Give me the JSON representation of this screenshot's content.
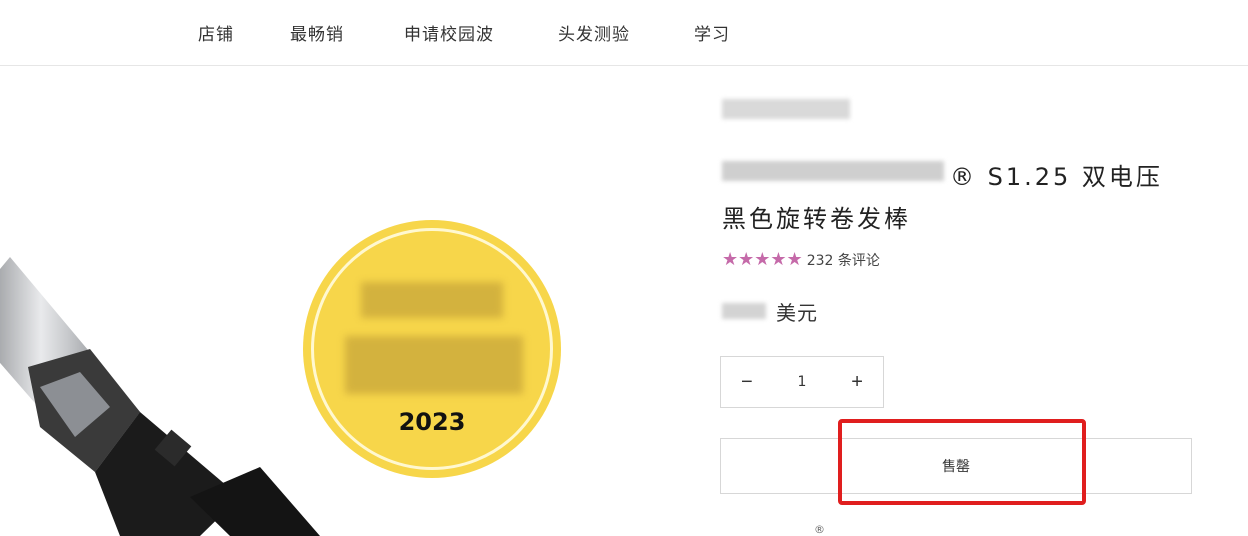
{
  "nav": {
    "items": [
      {
        "label": "店铺"
      },
      {
        "label": "最畅销"
      },
      {
        "label": "申请校园波"
      },
      {
        "label": "头发测验"
      },
      {
        "label": "学习"
      }
    ]
  },
  "media": {
    "badge": {
      "year": "2023",
      "color": "#f7d64a"
    }
  },
  "product": {
    "title_line1": "® S1.25 双电压",
    "title_line2": "黑色旋转卷发棒",
    "rating": {
      "stars": "★★★★★",
      "value": 5,
      "review_text": "232 条评论",
      "star_color": "#c56aa9"
    },
    "price": {
      "unit": "美元"
    },
    "quantity": {
      "decrease": "−",
      "value": "1",
      "increase": "+"
    },
    "sold_out_label": "售罄",
    "footnote_mark": "®"
  },
  "colors": {
    "highlight": "#e01e1e",
    "border": "#d7d7d7"
  }
}
